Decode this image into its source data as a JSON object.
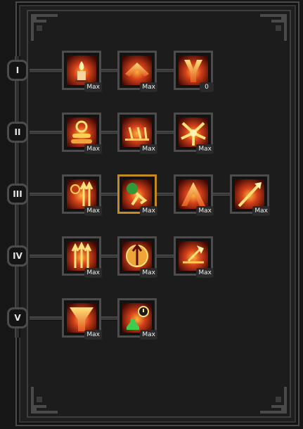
{
  "tiers": [
    {
      "label": "I",
      "skills": [
        {
          "name": "candle-skill-icon",
          "level": "Max"
        },
        {
          "name": "chevron-up-skill-icon",
          "level": "Max"
        },
        {
          "name": "fork-strike-skill-icon",
          "level": "0"
        }
      ]
    },
    {
      "label": "II",
      "skills": [
        {
          "name": "coin-stack-skill-icon",
          "level": "Max"
        },
        {
          "name": "chain-shot-skill-icon",
          "level": "Max"
        },
        {
          "name": "burst-skill-icon",
          "level": "Max"
        }
      ]
    },
    {
      "label": "III",
      "skills": [
        {
          "name": "twin-arrows-skill-icon",
          "level": "Max"
        },
        {
          "name": "dash-skill-icon",
          "level": "Max"
        },
        {
          "name": "peak-skill-icon",
          "level": "Max"
        },
        {
          "name": "spear-skill-icon",
          "level": "Max"
        }
      ]
    },
    {
      "label": "IV",
      "skills": [
        {
          "name": "triple-arrows-skill-icon",
          "level": "Max"
        },
        {
          "name": "arrow-orb-skill-icon",
          "level": "Max"
        },
        {
          "name": "axe-skill-icon",
          "level": "Max"
        }
      ]
    },
    {
      "label": "V",
      "skills": [
        {
          "name": "beam-skill-icon",
          "level": "Max"
        },
        {
          "name": "potion-skill-icon",
          "level": "Max"
        }
      ]
    }
  ],
  "colors": {
    "accent": "#c58a22",
    "fire_dark": "#5a0d04",
    "fire_mid": "#d4411a",
    "fire_light": "#ffcf52"
  }
}
